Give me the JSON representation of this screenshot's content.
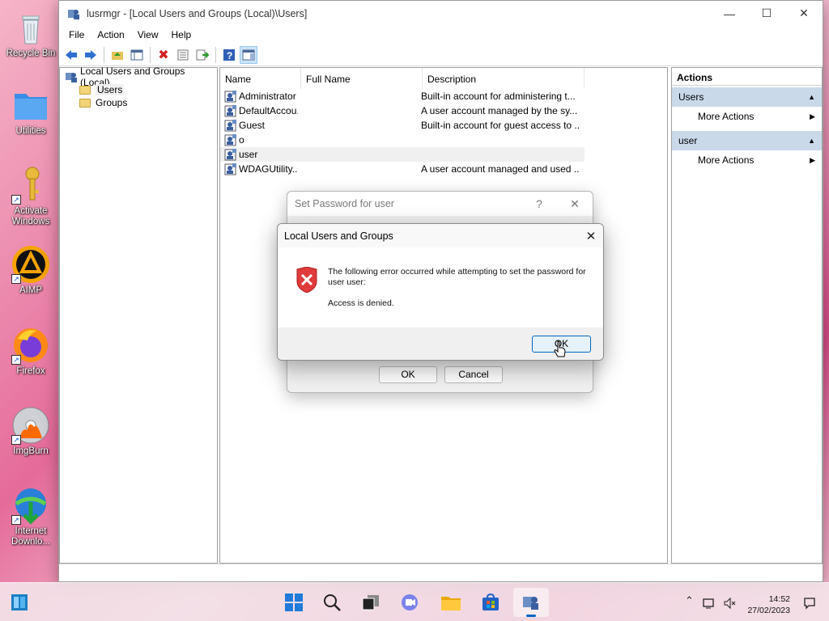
{
  "desktop": {
    "icons": [
      {
        "label": "Recycle Bin"
      },
      {
        "label": "Utilities"
      },
      {
        "label": "Activate Windows"
      },
      {
        "label": "AIMP"
      },
      {
        "label": "Firefox"
      },
      {
        "label": "ImgBurn"
      },
      {
        "label": "Internet Downlo..."
      }
    ]
  },
  "window": {
    "title": "lusrmgr - [Local Users and Groups (Local)\\Users]",
    "menu": [
      "File",
      "Action",
      "View",
      "Help"
    ],
    "tree": {
      "root": "Local Users and Groups (Local)",
      "children": [
        "Users",
        "Groups"
      ]
    },
    "list": {
      "columns": [
        "Name",
        "Full Name",
        "Description"
      ],
      "rows": [
        {
          "name": "Administrator",
          "full": "",
          "desc": "Built-in account for administering t..."
        },
        {
          "name": "DefaultAccou...",
          "full": "",
          "desc": "A user account managed by the sy..."
        },
        {
          "name": "Guest",
          "full": "",
          "desc": "Built-in account for guest access to ..."
        },
        {
          "name": "o",
          "full": "",
          "desc": ""
        },
        {
          "name": "user",
          "full": "",
          "desc": ""
        },
        {
          "name": "WDAGUtility...",
          "full": "",
          "desc": "A user account managed and used ..."
        }
      ]
    },
    "actions": {
      "title": "Actions",
      "group1": "Users",
      "group1_item": "More Actions",
      "group2": "user",
      "group2_item": "More Actions"
    }
  },
  "set_password_dialog": {
    "title": "Set Password for user",
    "help": "?",
    "ok": "OK",
    "cancel": "Cancel"
  },
  "error_dialog": {
    "title": "Local Users and Groups",
    "message": "The following error occurred while attempting to set the password for user user:",
    "detail": "Access is denied.",
    "ok": "OK"
  },
  "taskbar": {
    "time": "14:52",
    "date": "27/02/2023"
  },
  "colors": {
    "accent": "#0067c0",
    "selection": "#cce4f7",
    "error_red": "#e03a3a",
    "action_group": "#c9d9ea"
  }
}
